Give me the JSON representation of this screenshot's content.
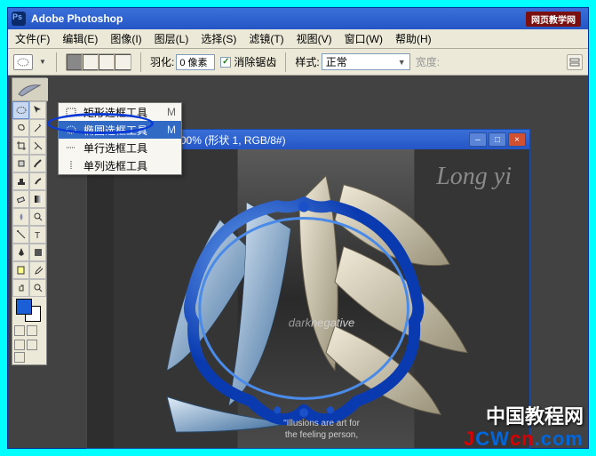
{
  "titlebar": {
    "app_name": "Adobe Photoshop",
    "badge": "网页教学网",
    "badge_url": "WWW.WEBJX.COM"
  },
  "menubar": {
    "file": "文件(F)",
    "edit": "编辑(E)",
    "image": "图像(I)",
    "layer": "图层(L)",
    "select": "选择(S)",
    "filter": "滤镜(T)",
    "view": "视图(V)",
    "window": "窗口(W)",
    "help": "帮助(H)"
  },
  "options": {
    "feather_label": "羽化:",
    "feather_value": "0 像素",
    "antialias_label": "消除锯齿",
    "style_label": "样式:",
    "style_value": "正常",
    "width_label": "宽度:"
  },
  "flyout": {
    "items": [
      {
        "label": "矩形选框工具",
        "shortcut": "M",
        "icon": "rect"
      },
      {
        "label": "椭圆选框工具",
        "shortcut": "M",
        "icon": "ellipse",
        "selected": true
      },
      {
        "label": "单行选框工具",
        "shortcut": "",
        "icon": "row"
      },
      {
        "label": "单列选框工具",
        "shortcut": "",
        "icon": "col"
      }
    ]
  },
  "document": {
    "title": "s.com龙依.jpg @ 100% (形状 1, RGB/8#)",
    "signature": "Long yi",
    "center_text_1": "dark",
    "center_text_2": "negative",
    "bottom_line1": "\"Illusions are art for",
    "bottom_line2": "the feeling person,"
  },
  "tools": {
    "marquee": "marquee",
    "move": "move",
    "lasso": "lasso",
    "wand": "wand",
    "crop": "crop",
    "slice": "slice",
    "heal": "heal",
    "brush": "brush",
    "stamp": "stamp",
    "history": "history",
    "eraser": "eraser",
    "gradient": "gradient",
    "blur": "blur",
    "dodge": "dodge",
    "pen": "pen",
    "type": "type",
    "path": "path",
    "shape": "shape",
    "notes": "notes",
    "eyedrop": "eyedrop",
    "hand": "hand",
    "zoom": "zoom"
  },
  "colors": {
    "fg": "#1a5fd6",
    "bg": "#ffffff"
  },
  "watermark": {
    "line1": "中国教程网",
    "line2a": "J",
    "line2b": "CW",
    "line2c": "cn",
    "line2d": ".com"
  }
}
